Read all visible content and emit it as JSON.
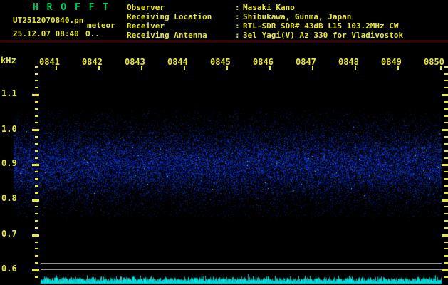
{
  "window": {
    "app_title": "H R O F F T"
  },
  "header": {
    "filename": "UT2512070840.pn",
    "mode": "meteor",
    "datetime": "25.12.07 08:40",
    "counter": "O..",
    "separator": ":",
    "info": [
      {
        "label": "Observer",
        "value": "Masaki Kano"
      },
      {
        "label": "Receiving Location",
        "value": "Shibukawa, Gunma, Japan"
      },
      {
        "label": "Receiver",
        "value": "RTL-SDR SDR# 43dB L15 103.2MHz CW"
      },
      {
        "label": "Receiving Antenna",
        "value": "3el Yagi(V) Az 330 for Vladivostok"
      }
    ]
  },
  "axes": {
    "freq_unit": "kHz",
    "time_labels": [
      "0841",
      "0842",
      "0843",
      "0844",
      "0845",
      "0846",
      "0847",
      "0848",
      "0849",
      "0850"
    ],
    "freq_labels": [
      "1.1",
      "1.0",
      "0.9",
      "0.8",
      "0.7",
      "0.6"
    ]
  },
  "spectrogram": {
    "type": "spectrogram",
    "freq_label_range_khz": [
      0.6,
      1.1
    ],
    "noise_band_khz": [
      0.8,
      1.0
    ],
    "time_range": [
      "0841",
      "0850"
    ]
  },
  "colors": {
    "yellow": "#e8e830",
    "green": "#00cc55",
    "noise_blue": "#2233dd",
    "waveform_cyan": "#00dcdc",
    "line_gray": "#909090",
    "separator_maroon": "#2e0808"
  }
}
